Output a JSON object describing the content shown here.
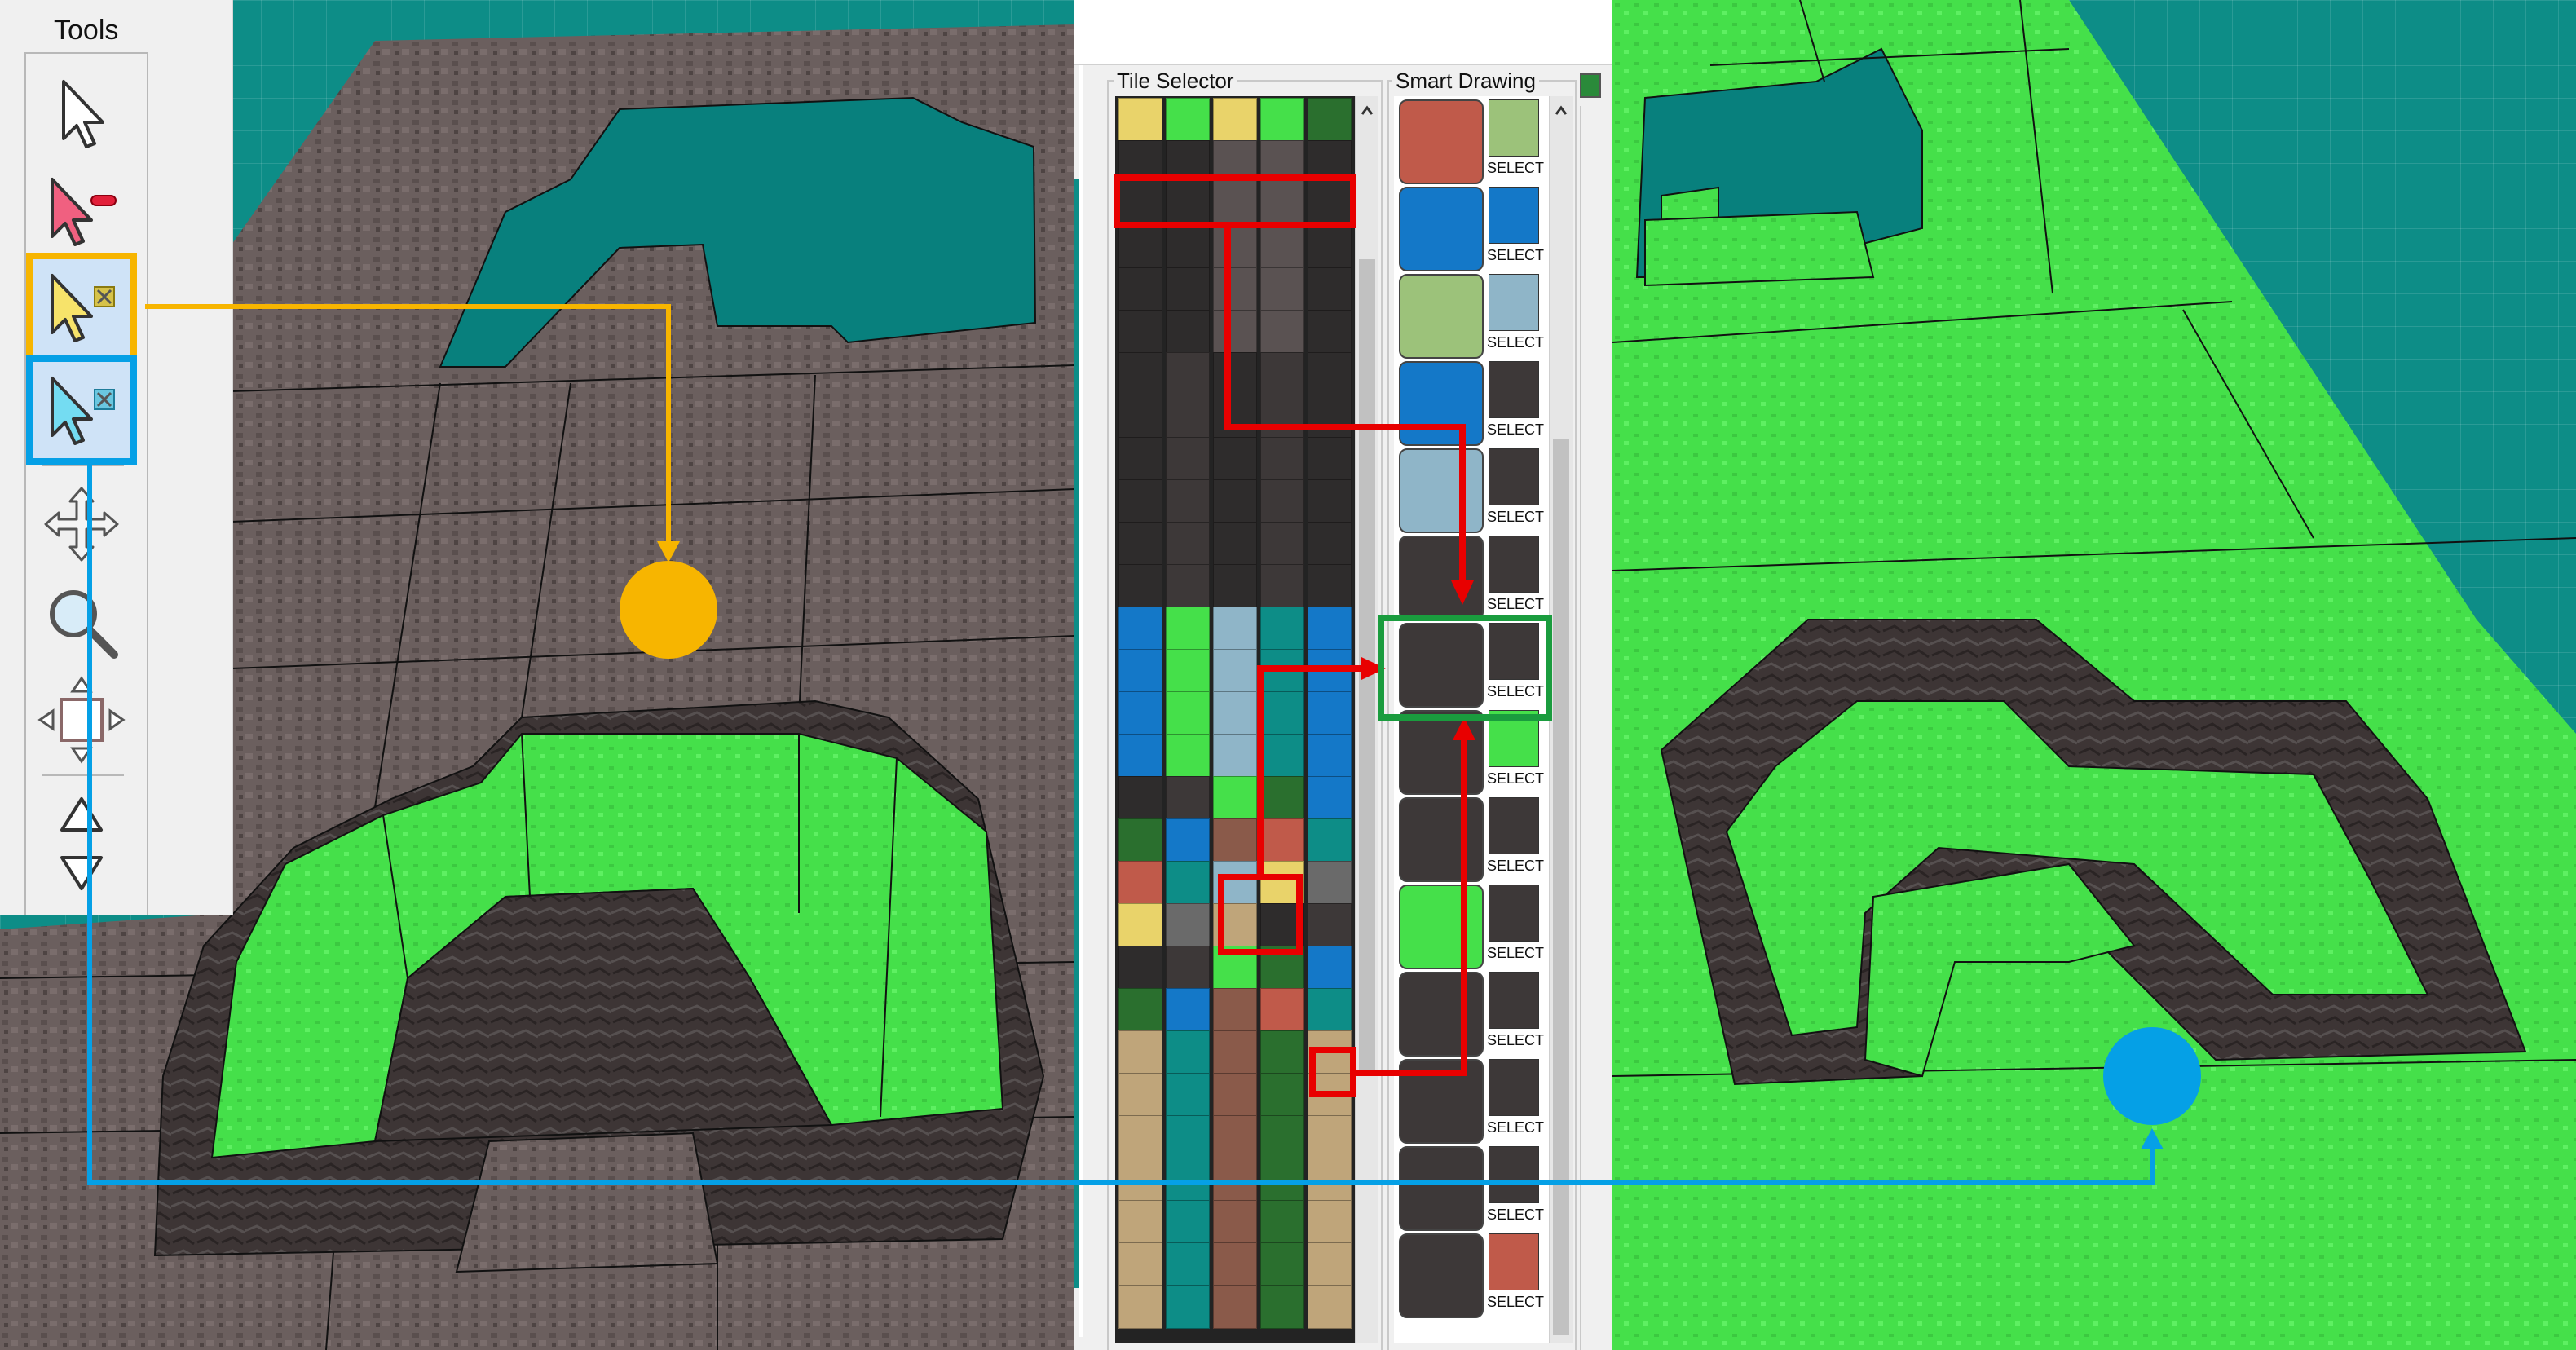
{
  "tools_panel": {
    "title": "Tools",
    "items": [
      {
        "name": "select",
        "icon": "arrow-pointer-icon"
      },
      {
        "name": "select-remove",
        "icon": "arrow-pointer-minus-icon"
      },
      {
        "name": "select-yellow",
        "icon": "arrow-pointer-yellow-icon",
        "highlight": "#f7b500"
      },
      {
        "name": "select-blue",
        "icon": "arrow-pointer-blue-icon",
        "highlight": "#05a0e6"
      },
      {
        "name": "move",
        "icon": "move-arrows-icon"
      },
      {
        "name": "zoom",
        "icon": "magnifier-icon"
      },
      {
        "name": "resize",
        "icon": "resize-box-icon"
      },
      {
        "name": "raise",
        "icon": "triangle-up-icon"
      },
      {
        "name": "lower",
        "icon": "triangle-down-icon"
      }
    ]
  },
  "tile_selector": {
    "label": "Tile Selector"
  },
  "smart_drawing": {
    "label": "Smart Drawing",
    "select_label": "SELECT",
    "select_partial": "SELECI",
    "select_partial2": "SELECT"
  },
  "colors": {
    "rock": "#6b5f5e",
    "grass": "#45e04a",
    "water": "#08807d",
    "annotation_yellow": "#f7b500",
    "annotation_blue": "#05a0e6",
    "annotation_red": "#e80000",
    "annotation_green": "#1a9c3e"
  }
}
